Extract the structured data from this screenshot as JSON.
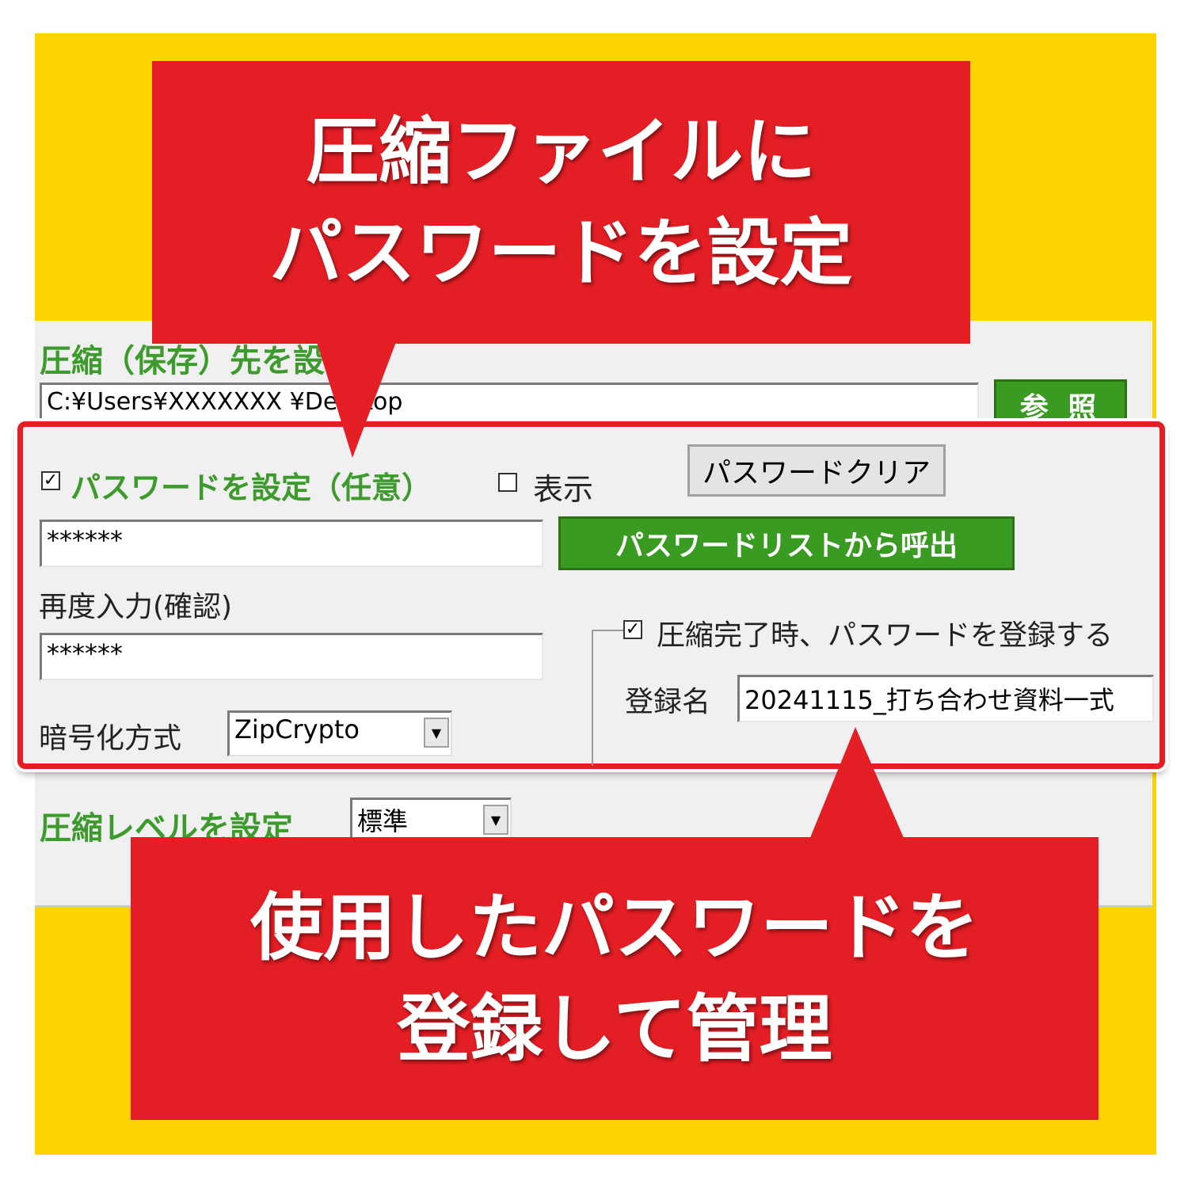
{
  "top_banner": {
    "line1": "圧縮ファイルに",
    "line2": "パスワードを設定"
  },
  "bottom_banner": {
    "line1": "使用したパスワードを",
    "line2": "登録して管理"
  },
  "destination": {
    "label": "圧縮（保存）先を設",
    "path": "C:¥Users¥XXXXXXX ¥Desktop",
    "browse_button": "参 照"
  },
  "password_section": {
    "set_password_checked": true,
    "set_password_label": "パスワードを設定（任意）",
    "show_checked": false,
    "show_label": "表示",
    "clear_button": "パスワードクリア",
    "password_value": "******",
    "call_from_list_button": "パスワードリストから呼出",
    "reenter_label": "再度入力(確認)",
    "confirm_value": "******",
    "encryption_label": "暗号化方式",
    "encryption_value": "ZipCrypto",
    "register_checked": true,
    "register_label": "圧縮完了時、パスワードを登録する",
    "register_name_label": "登録名",
    "register_name_value": "20241115_打ち合わせ資料一式"
  },
  "compression_level": {
    "label": "圧縮レベルを設定",
    "value": "標準"
  },
  "colors": {
    "yellow": "#fdd400",
    "red": "#e31e24",
    "green": "#3a9b22"
  }
}
